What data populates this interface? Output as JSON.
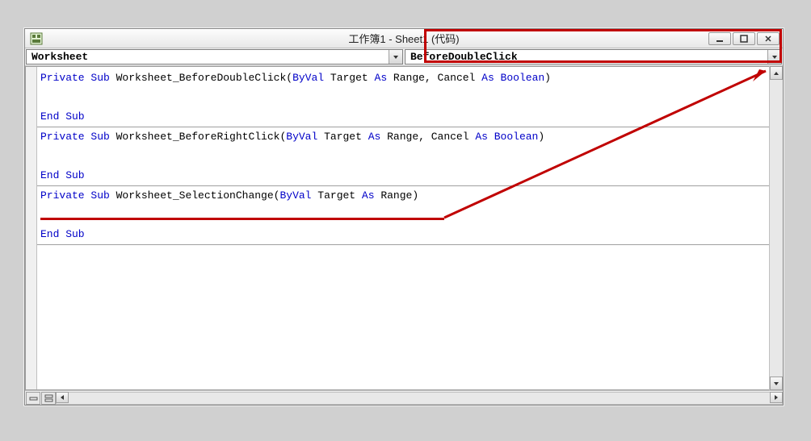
{
  "titlebar": {
    "title": "工作簿1 - Sheet1 (代码)"
  },
  "dropdowns": {
    "object": "Worksheet",
    "procedure": "BeforeDoubleClick"
  },
  "code": {
    "sub1_decl_a": "Private Sub",
    "sub1_decl_b": " Worksheet_BeforeDoubleClick(",
    "sub1_decl_c": "ByVal",
    "sub1_decl_d": " Target ",
    "sub1_decl_e": "As",
    "sub1_decl_f": " Range, Cancel ",
    "sub1_decl_g": "As Boolean",
    "sub1_decl_h": ")",
    "endsub": "End Sub",
    "sub2_decl_a": "Private Sub",
    "sub2_decl_b": " Worksheet_BeforeRightClick(",
    "sub2_decl_c": "ByVal",
    "sub2_decl_d": " Target ",
    "sub2_decl_e": "As",
    "sub2_decl_f": " Range, Cancel ",
    "sub2_decl_g": "As Boolean",
    "sub2_decl_h": ")",
    "sub3_decl_a": "Private Sub",
    "sub3_decl_b": " Worksheet_SelectionChange(",
    "sub3_decl_c": "ByVal",
    "sub3_decl_d": " Target ",
    "sub3_decl_e": "As",
    "sub3_decl_f": " Range)"
  }
}
